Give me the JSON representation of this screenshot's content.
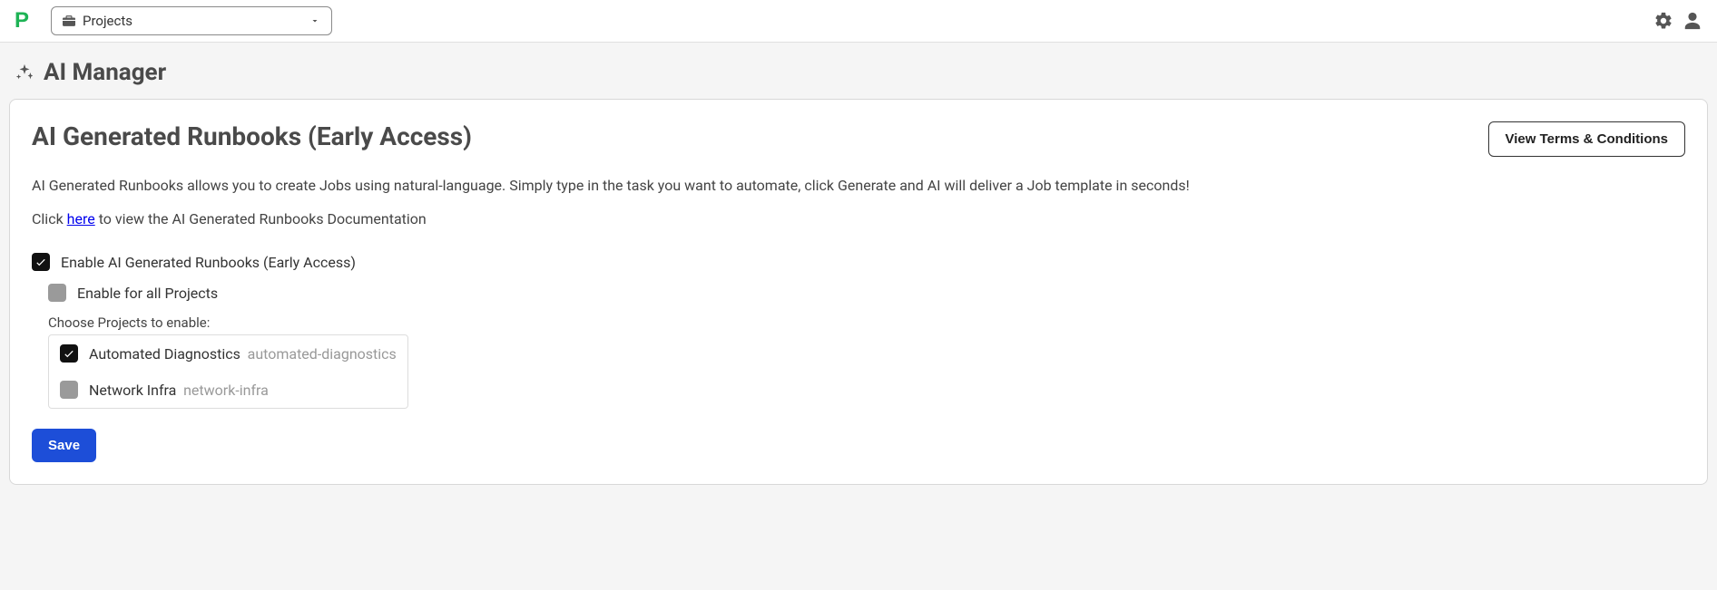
{
  "topbar": {
    "project_selector_label": "Projects"
  },
  "page": {
    "title": "AI Manager"
  },
  "card": {
    "title": "AI Generated Runbooks (Early Access)",
    "terms_button": "View Terms & Conditions",
    "description": "AI Generated Runbooks allows you to create Jobs using natural-language. Simply type in the task you want to automate, click Generate and AI will deliver a Job template in seconds!",
    "docs_prefix": "Click ",
    "docs_link": "here",
    "docs_suffix": " to view the AI Generated Runbooks Documentation",
    "enable_label": "Enable AI Generated Runbooks (Early Access)",
    "enable_all_label": "Enable for all Projects",
    "choose_label": "Choose Projects to enable:",
    "projects": [
      {
        "name": "Automated Diagnostics",
        "id": "automated-diagnostics",
        "checked": true
      },
      {
        "name": "Network Infra",
        "id": "network-infra",
        "checked": false
      }
    ],
    "save_button": "Save"
  }
}
